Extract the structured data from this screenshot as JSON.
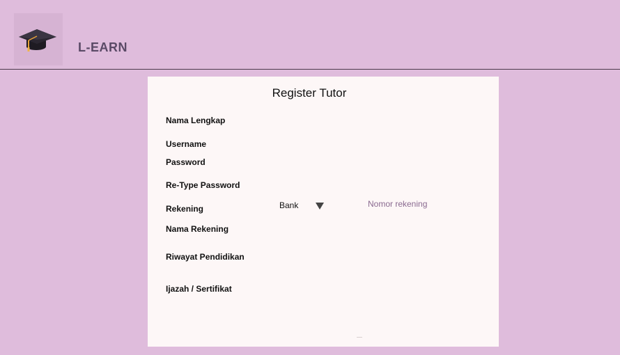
{
  "app": {
    "brand": "L-EARN",
    "logo_icon": "graduation-cap-icon"
  },
  "form": {
    "title": "Register Tutor",
    "labels": {
      "full_name": "Nama Lengkap",
      "username": "Username",
      "password": "Password",
      "retype_password": "Re-Type Password",
      "account": "Rekening",
      "account_name": "Nama Rekening",
      "education": "Riwayat Pendidikan",
      "certificate": "Ijazah / Sertifikat"
    },
    "bank_select": {
      "selected": "Bank"
    },
    "account_number": {
      "placeholder": "Nomor rekening",
      "value": ""
    }
  },
  "colors": {
    "background": "#dfbcdc",
    "card": "#fdf7f7",
    "brand_text": "#5a4a66"
  }
}
